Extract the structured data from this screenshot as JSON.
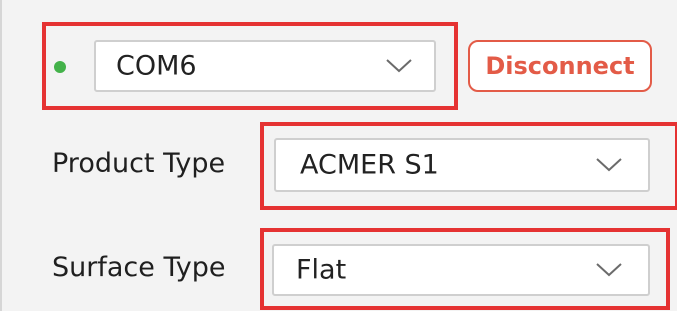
{
  "port": {
    "status_color": "#43b24a",
    "selected": "COM6",
    "chevron_icon": "chevron-down-icon"
  },
  "disconnect_button": {
    "label": "Disconnect",
    "color": "#e35b47"
  },
  "product_type": {
    "label": "Product Type",
    "selected": "ACMER S1"
  },
  "surface_type": {
    "label": "Surface Type",
    "selected": "Flat"
  },
  "highlight_color": "#e53232"
}
